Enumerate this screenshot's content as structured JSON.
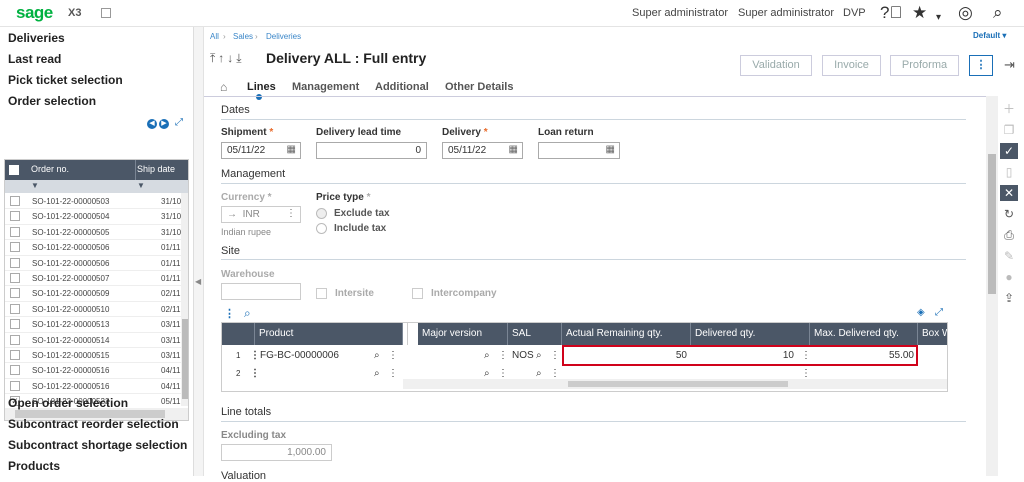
{
  "topbar": {
    "logo": "sage",
    "product": "X3",
    "user1": "Super administrator",
    "user2": "Super administrator",
    "folder": "DVP"
  },
  "sidebar": {
    "headings": [
      "Deliveries",
      "Last read",
      "Pick ticket selection",
      "Order selection"
    ],
    "bottom_headings": [
      "Open order selection",
      "Subcontract reorder selection",
      "Subcontract shortage selection",
      "Products"
    ],
    "grid": {
      "col_no": "Order no.",
      "col_date": "Ship date",
      "rows": [
        {
          "no": "SO-101-22-00000503",
          "date": "31/10",
          "checked": false
        },
        {
          "no": "SO-101-22-00000504",
          "date": "31/10",
          "checked": false
        },
        {
          "no": "SO-101-22-00000505",
          "date": "31/10",
          "checked": false
        },
        {
          "no": "SO-101-22-00000506",
          "date": "01/11",
          "checked": false
        },
        {
          "no": "SO-101-22-00000506",
          "date": "01/11",
          "checked": false
        },
        {
          "no": "SO-101-22-00000507",
          "date": "01/11",
          "checked": false
        },
        {
          "no": "SO-101-22-00000509",
          "date": "02/11",
          "checked": false
        },
        {
          "no": "SO-101-22-00000510",
          "date": "02/11",
          "checked": false
        },
        {
          "no": "SO-101-22-00000513",
          "date": "03/11",
          "checked": false
        },
        {
          "no": "SO-101-22-00000514",
          "date": "03/11",
          "checked": false
        },
        {
          "no": "SO-101-22-00000515",
          "date": "03/11",
          "checked": false
        },
        {
          "no": "SO-101-22-00000516",
          "date": "04/11",
          "checked": false
        },
        {
          "no": "SO-101-22-00000516",
          "date": "04/11",
          "checked": false
        },
        {
          "no": "SO-101-22-00000522",
          "date": "05/11",
          "checked": true
        }
      ]
    }
  },
  "breadcrumb": [
    "All",
    "Sales",
    "Deliveries"
  ],
  "default_label": "Default",
  "page_title": "Delivery ALL : Full entry",
  "buttons": {
    "validation": "Validation",
    "invoice": "Invoice",
    "proforma": "Proforma"
  },
  "tabs": [
    "Lines",
    "Management",
    "Additional",
    "Other Details"
  ],
  "sections": {
    "dates": "Dates",
    "management": "Management",
    "site": "Site",
    "line_totals": "Line totals",
    "valuation": "Valuation"
  },
  "fields": {
    "shipment": {
      "label": "Shipment",
      "value": "05/11/22"
    },
    "delivery_lead_time": {
      "label": "Delivery lead time",
      "value": "0"
    },
    "delivery": {
      "label": "Delivery",
      "value": "05/11/22"
    },
    "loan_return": {
      "label": "Loan return",
      "value": ""
    },
    "currency": {
      "label": "Currency",
      "value": "INR",
      "desc": "Indian rupee"
    },
    "price_type": {
      "label": "Price type",
      "opt1": "Exclude tax",
      "opt2": "Include tax"
    },
    "warehouse": {
      "label": "Warehouse",
      "value": ""
    },
    "intersite": "Intersite",
    "intercompany": "Intercompany",
    "excluding_tax": {
      "label": "Excluding tax",
      "value": "1,000.00"
    }
  },
  "lines_grid": {
    "headers": [
      "Product",
      "Major version",
      "SAL",
      "Actual Remaining qty.",
      "Delivered qty.",
      "Max. Delivered qty.",
      "Box Wi"
    ],
    "rows": [
      {
        "n": "1",
        "product": "FG-BC-00000006",
        "sal": "NOS",
        "remaining": "50",
        "delivered": "10",
        "max": "55.00"
      },
      {
        "n": "2",
        "product": "",
        "sal": "",
        "remaining": "",
        "delivered": "",
        "max": ""
      }
    ]
  }
}
